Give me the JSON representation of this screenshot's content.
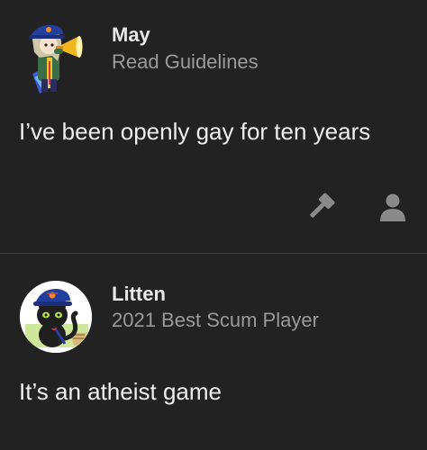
{
  "posts": [
    {
      "username": "May",
      "user_title": "Read Guidelines",
      "avatar_icon": "cartoon-character-megaphone-avatar",
      "body": "I’ve been openly gay for ten years",
      "actions": [
        {
          "icon": "gavel-icon"
        },
        {
          "icon": "user-icon"
        }
      ]
    },
    {
      "username": "Litten",
      "user_title": "2021 Best Scum Player",
      "avatar_icon": "black-cat-captain-hat-avatar",
      "body": "It’s an atheist game"
    }
  ],
  "colors": {
    "background": "#222222",
    "divider": "#3c3c3c",
    "text": "#efefef",
    "muted": "#9a9a9a",
    "icon": "#8a8a8a"
  }
}
